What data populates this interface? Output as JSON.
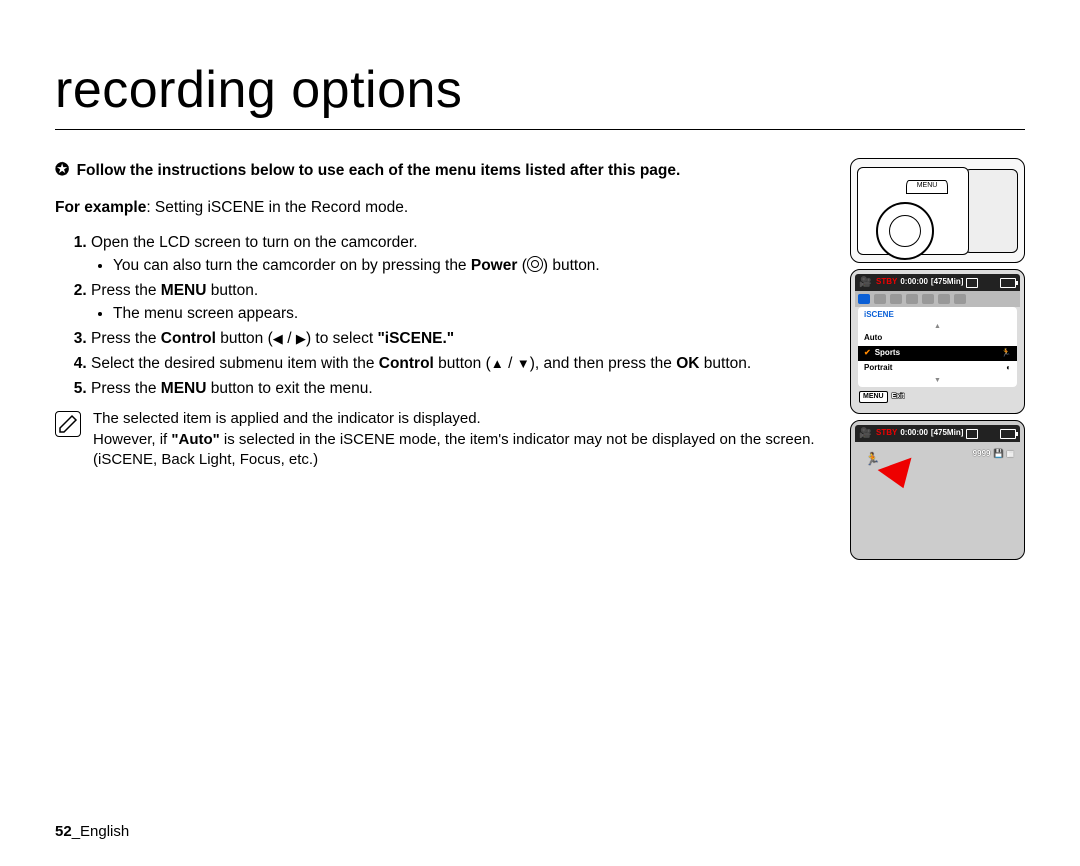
{
  "title": "recording options",
  "intro": {
    "star": "✪",
    "text": "Follow the instructions below to use each of the menu items listed after this page."
  },
  "example": {
    "label": "For example",
    "text": ": Setting iSCENE in the Record mode."
  },
  "steps": {
    "s1": "Open the LCD screen to turn on the camcorder.",
    "s1_sub_a": "You can also turn the camcorder on by pressing the ",
    "s1_sub_b": "Power",
    "s1_sub_c": " button.",
    "s2_a": "Press the ",
    "s2_b": "MENU",
    "s2_c": " button.",
    "s2_sub": "The menu screen appears.",
    "s3_a": "Press the ",
    "s3_b": "Control",
    "s3_c": " button (",
    "s3_d": " / ",
    "s3_e": ") to select ",
    "s3_f": "\"iSCENE.\"",
    "s4_a": "Select the desired submenu item with the ",
    "s4_b": "Control",
    "s4_c": " button (",
    "s4_d": " / ",
    "s4_e": "), and then press the ",
    "s4_f": "OK",
    "s4_g": " button.",
    "s5_a": "Press the ",
    "s5_b": "MENU",
    "s5_c": " button to exit the menu."
  },
  "note": {
    "line1": "The selected item is applied and the indicator is displayed.",
    "line2a": "However, if ",
    "line2b": "\"Auto\"",
    "line2c": " is selected in the iSCENE mode, the item's indicator may not be displayed on the screen. (iSCENE, Back Light, Focus, etc.)"
  },
  "cam_illus": {
    "menu_label": "MENU"
  },
  "screen1": {
    "stby": "STBY",
    "time": "0:00:00",
    "remain": "[475Min]",
    "tab": "iSCENE",
    "items": [
      "Auto",
      "Sports",
      "Portrait"
    ],
    "selected_index": 1,
    "menu_label": "MENU",
    "exit_label": "Exit"
  },
  "screen2": {
    "stby": "STBY",
    "time": "0:00:00",
    "remain": "[475Min]",
    "counter": "9999"
  },
  "footer": {
    "page": "52",
    "sep": "_",
    "lang": "English"
  }
}
